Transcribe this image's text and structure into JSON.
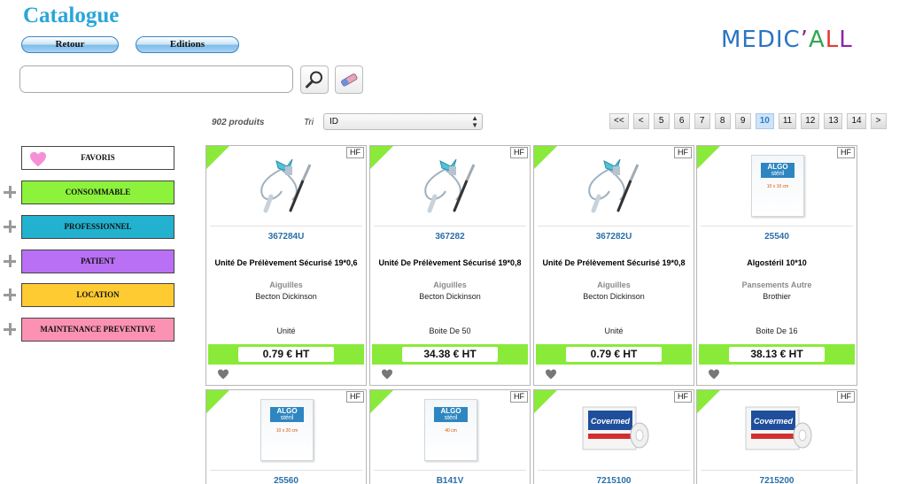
{
  "header": {
    "title": "Catalogue",
    "buttons": {
      "retour": "Retour",
      "editions": "Editions"
    },
    "logo": {
      "part1": "MEDIC",
      "apostrophe": "’",
      "part2": "ALL"
    }
  },
  "search": {
    "value": "",
    "placeholder": ""
  },
  "listing": {
    "count_label": "902 produits",
    "sort_label": "Tri",
    "sort_value": "ID"
  },
  "pagination": [
    "<<",
    "<",
    "5",
    "6",
    "7",
    "8",
    "9",
    "10",
    "11",
    "12",
    "13",
    "14",
    ">"
  ],
  "pagination_current": "10",
  "categories": [
    {
      "label": "FAVORIS",
      "color": "#ffffff"
    },
    {
      "label": "CONSOMMABLE",
      "color": "#8cf23c"
    },
    {
      "label": "PROFESSIONNEL",
      "color": "#22b1cf"
    },
    {
      "label": "PATIENT",
      "color": "#b970f4"
    },
    {
      "label": "LOCATION",
      "color": "#ffcb33"
    },
    {
      "label": "MAINTENANCE PREVENTIVE",
      "color": "#fb92b3"
    }
  ],
  "products": [
    {
      "badge": "HF",
      "ref": "367284U",
      "name": "Unité De Prélèvement Sécurisé 19*0,6",
      "category": "Aiguilles",
      "brand": "Becton Dickinson",
      "conditioning": "Unité",
      "price": "0.79 € HT",
      "image": "blood-collection-set"
    },
    {
      "badge": "HF",
      "ref": "367282",
      "name": "Unité De Prélèvement Sécurisé 19*0,8",
      "category": "Aiguilles",
      "brand": "Becton Dickinson",
      "conditioning": "Boite De 50",
      "price": "34.38 € HT",
      "image": "blood-collection-set"
    },
    {
      "badge": "HF",
      "ref": "367282U",
      "name": "Unité De Prélèvement Sécurisé 19*0,8",
      "category": "Aiguilles",
      "brand": "Becton Dickinson",
      "conditioning": "Unité",
      "price": "0.79 € HT",
      "image": "blood-collection-set"
    },
    {
      "badge": "HF",
      "ref": "25540",
      "name": "Algostéril 10*10",
      "category": "Pansements Autre",
      "brand": "Brothier",
      "conditioning": "Boite De 16",
      "price": "38.13 € HT",
      "image": "algosteril-box",
      "box_lines": [
        "ALGO",
        "stéril",
        "10 x 10 cm"
      ]
    },
    {
      "badge": "HF",
      "ref": "25560",
      "image": "algosteril-box",
      "box_lines": [
        "ALGO",
        "stéril",
        "10 x 20 cm"
      ]
    },
    {
      "badge": "HF",
      "ref": "B141V",
      "image": "algosteril-box",
      "box_lines": [
        "ALGO",
        "stéril",
        "40 cm"
      ]
    },
    {
      "badge": "HF",
      "ref": "7215100",
      "image": "covermed-roll",
      "box_lines": [
        "Covermed"
      ]
    },
    {
      "badge": "HF",
      "ref": "7215200",
      "image": "covermed-roll",
      "box_lines": [
        "Covermed"
      ]
    }
  ],
  "colors": {
    "title": "#2aa6d8",
    "price_band": "#8aea3a",
    "ref": "#2a6fa8",
    "active_page": "#2c7fc9"
  }
}
